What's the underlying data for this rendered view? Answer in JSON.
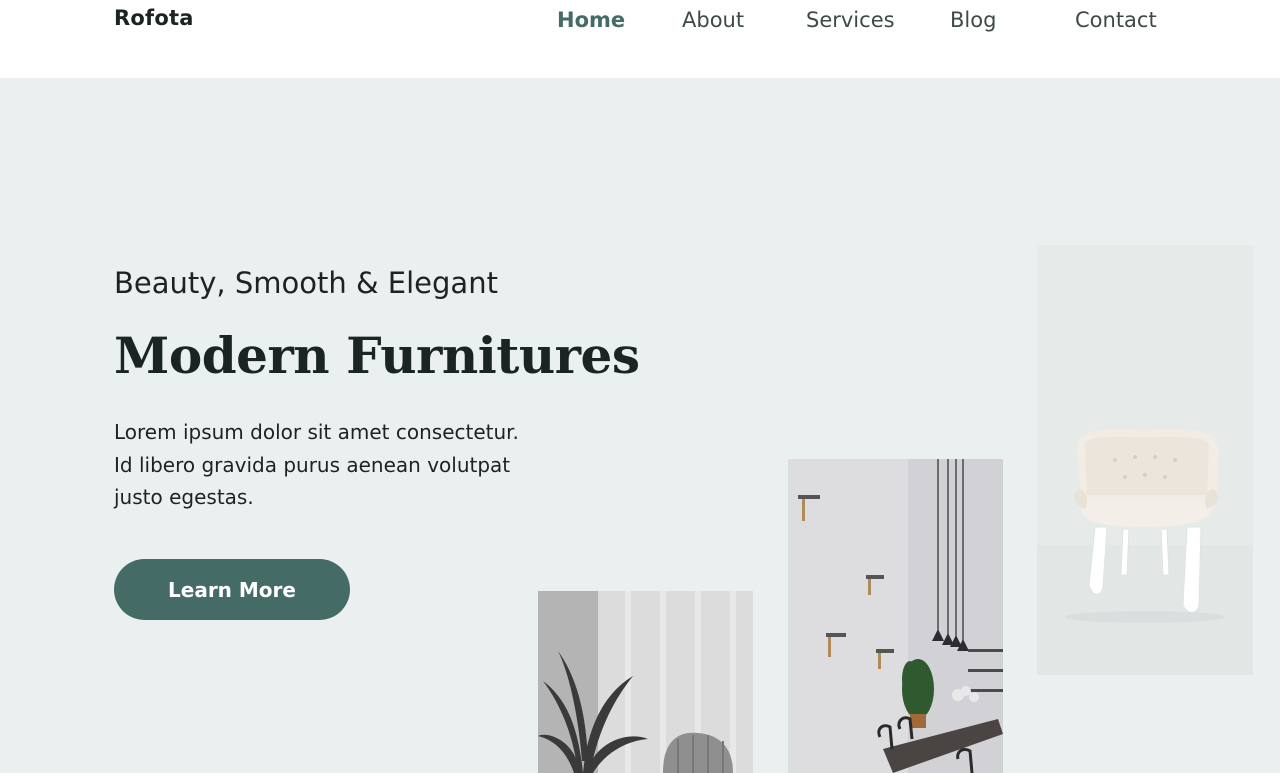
{
  "header": {
    "logo": "Rofota",
    "nav": [
      {
        "label": "Home",
        "active": true
      },
      {
        "label": "About",
        "active": false
      },
      {
        "label": "Services",
        "active": false
      },
      {
        "label": "Blog",
        "active": false
      },
      {
        "label": "Contact",
        "active": false
      }
    ]
  },
  "hero": {
    "subtitle": "Beauty, Smooth & Elegant",
    "title": "Modern Furnitures",
    "description": "Lorem ipsum dolor sit amet consectetur. Id libero gravida purus aenean volutpat justo egestas.",
    "cta_label": "Learn More"
  },
  "images": [
    {
      "name": "plant-armchair-photo"
    },
    {
      "name": "dining-room-photo"
    },
    {
      "name": "cream-chair-photo"
    }
  ],
  "colors": {
    "accent": "#456b66",
    "hero_background": "#eaf0ef",
    "text": "#1d2322"
  }
}
